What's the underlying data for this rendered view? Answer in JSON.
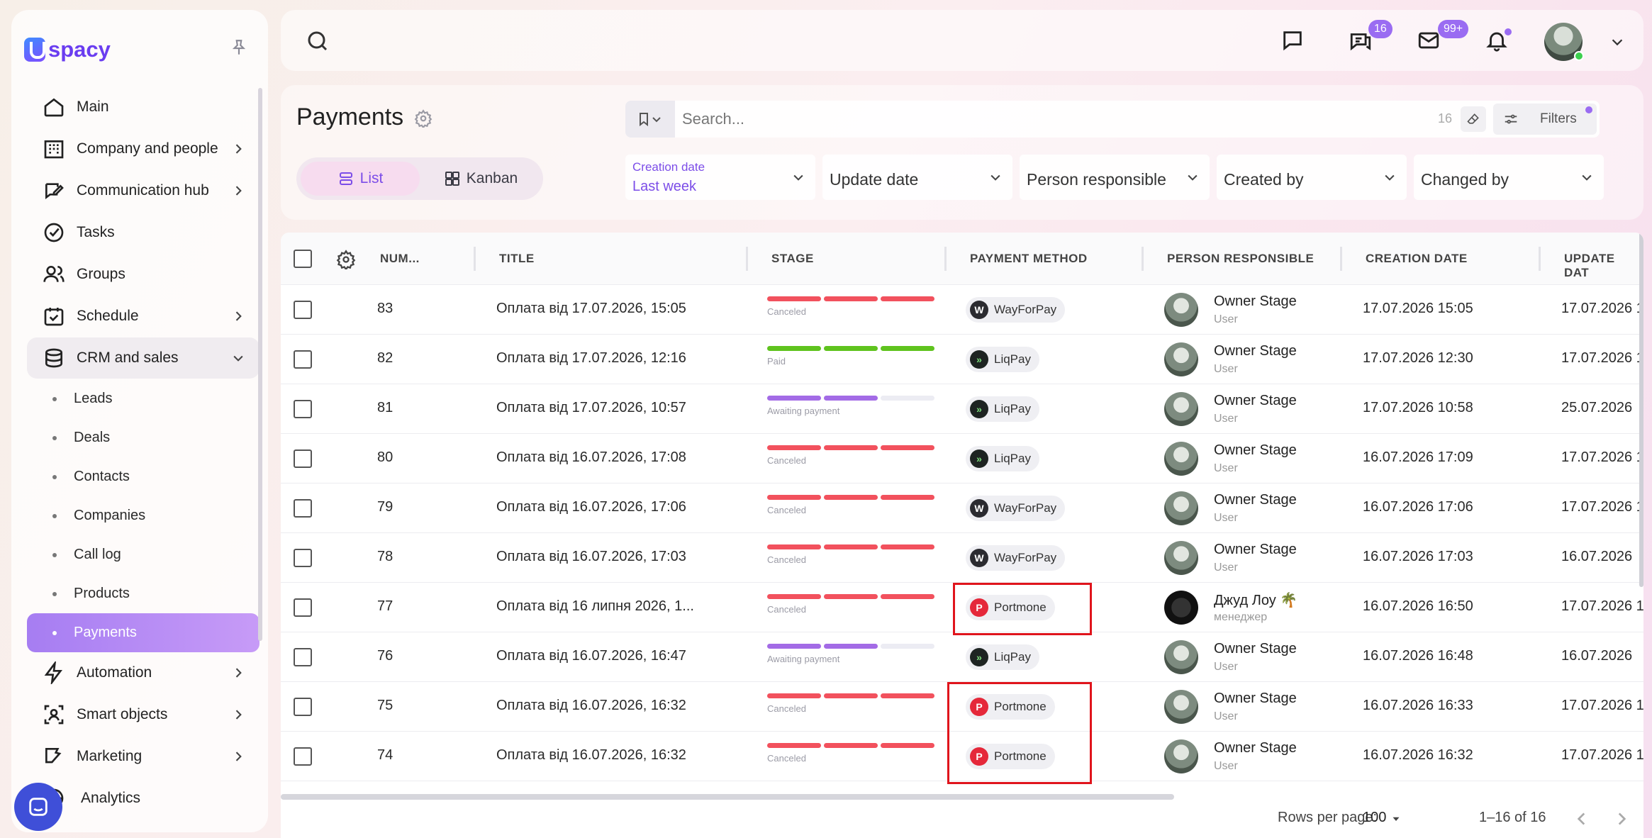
{
  "app": {
    "logo_text": "spacy",
    "brand_color": "#6a3df0",
    "accent_color": "#9a6cf2"
  },
  "sidebar": {
    "items": [
      {
        "label": "Main",
        "icon": "home-icon"
      },
      {
        "label": "Company and people",
        "icon": "building-icon"
      },
      {
        "label": "Communication hub",
        "icon": "edit-chat-icon"
      },
      {
        "label": "Tasks",
        "icon": "check-circle-icon"
      },
      {
        "label": "Groups",
        "icon": "users-icon"
      },
      {
        "label": "Schedule",
        "icon": "calendar-icon"
      },
      {
        "label": "CRM and sales",
        "icon": "database-icon"
      }
    ],
    "crm_sub_items": [
      {
        "label": "Leads"
      },
      {
        "label": "Deals"
      },
      {
        "label": "Contacts"
      },
      {
        "label": "Companies"
      },
      {
        "label": "Call log"
      },
      {
        "label": "Products"
      },
      {
        "label": "Payments"
      }
    ],
    "bottom_items": [
      {
        "label": "Automation",
        "icon": "lightning-icon"
      },
      {
        "label": "Smart objects",
        "icon": "smart-object-icon"
      },
      {
        "label": "Marketing",
        "icon": "marketing-icon"
      },
      {
        "label": "Analytics",
        "icon": "analytics-icon"
      }
    ]
  },
  "topbar": {
    "chat_badge": "16",
    "mail_badge": "99+"
  },
  "page": {
    "title": "Payments",
    "view_list": "List",
    "view_kanban": "Kanban"
  },
  "search": {
    "placeholder": "Search...",
    "count": "16",
    "filters_label": "Filters"
  },
  "filters": {
    "creation_date_label": "Creation date",
    "creation_date_value": "Last week",
    "update_date": "Update date",
    "person_responsible": "Person responsible",
    "created_by": "Created by",
    "changed_by": "Changed by"
  },
  "table": {
    "columns": [
      "NUM...",
      "TITLE",
      "STAGE",
      "PAYMENT METHOD",
      "PERSON RESPONSIBLE",
      "CREATION DATE",
      "UPDATE DAT"
    ],
    "stage_colors": {
      "Canceled": "#f2515d",
      "Paid": "#5fc31e",
      "Awaiting payment": "#a36be6"
    },
    "rows": [
      {
        "num": "83",
        "title": "Оплата від 17.07.2026, 15:05",
        "stage": "Canceled",
        "method": "WayForPay",
        "person": "Owner Stage",
        "role": "User",
        "created": "17.07.2026 15:05",
        "updated": "17.07.2026 1"
      },
      {
        "num": "82",
        "title": "Оплата від 17.07.2026, 12:16",
        "stage": "Paid",
        "method": "LiqPay",
        "person": "Owner Stage",
        "role": "User",
        "created": "17.07.2026 12:30",
        "updated": "17.07.2026 1"
      },
      {
        "num": "81",
        "title": "Оплата від 17.07.2026, 10:57",
        "stage": "Awaiting payment",
        "method": "LiqPay",
        "person": "Owner Stage",
        "role": "User",
        "created": "17.07.2026 10:58",
        "updated": "25.07.2026"
      },
      {
        "num": "80",
        "title": "Оплата від 16.07.2026, 17:08",
        "stage": "Canceled",
        "method": "LiqPay",
        "person": "Owner Stage",
        "role": "User",
        "created": "16.07.2026 17:09",
        "updated": "17.07.2026 1"
      },
      {
        "num": "79",
        "title": "Оплата від 16.07.2026, 17:06",
        "stage": "Canceled",
        "method": "WayForPay",
        "person": "Owner Stage",
        "role": "User",
        "created": "16.07.2026 17:06",
        "updated": "17.07.2026 1"
      },
      {
        "num": "78",
        "title": "Оплата від 16.07.2026, 17:03",
        "stage": "Canceled",
        "method": "WayForPay",
        "person": "Owner Stage",
        "role": "User",
        "created": "16.07.2026 17:03",
        "updated": "16.07.2026"
      },
      {
        "num": "77",
        "title": "Оплата від 16 липня 2026, 1...",
        "stage": "Canceled",
        "method": "Portmone",
        "person": "Джуд Лоу 🌴",
        "role": "менеджер",
        "created": "16.07.2026 16:50",
        "updated": "17.07.2026 1"
      },
      {
        "num": "76",
        "title": "Оплата від 16.07.2026, 16:47",
        "stage": "Awaiting payment",
        "method": "LiqPay",
        "person": "Owner Stage",
        "role": "User",
        "created": "16.07.2026 16:48",
        "updated": "16.07.2026"
      },
      {
        "num": "75",
        "title": "Оплата від 16.07.2026, 16:32",
        "stage": "Canceled",
        "method": "Portmone",
        "person": "Owner Stage",
        "role": "User",
        "created": "16.07.2026 16:33",
        "updated": "17.07.2026 1"
      },
      {
        "num": "74",
        "title": "Оплата від 16.07.2026, 16:32",
        "stage": "Canceled",
        "method": "Portmone",
        "person": "Owner Stage",
        "role": "User",
        "created": "16.07.2026 16:32",
        "updated": "17.07.2026 1"
      }
    ]
  },
  "footer": {
    "rows_per_page_label": "Rows per page:",
    "rows_per_page_value": "100",
    "range": "1–16 of 16"
  }
}
